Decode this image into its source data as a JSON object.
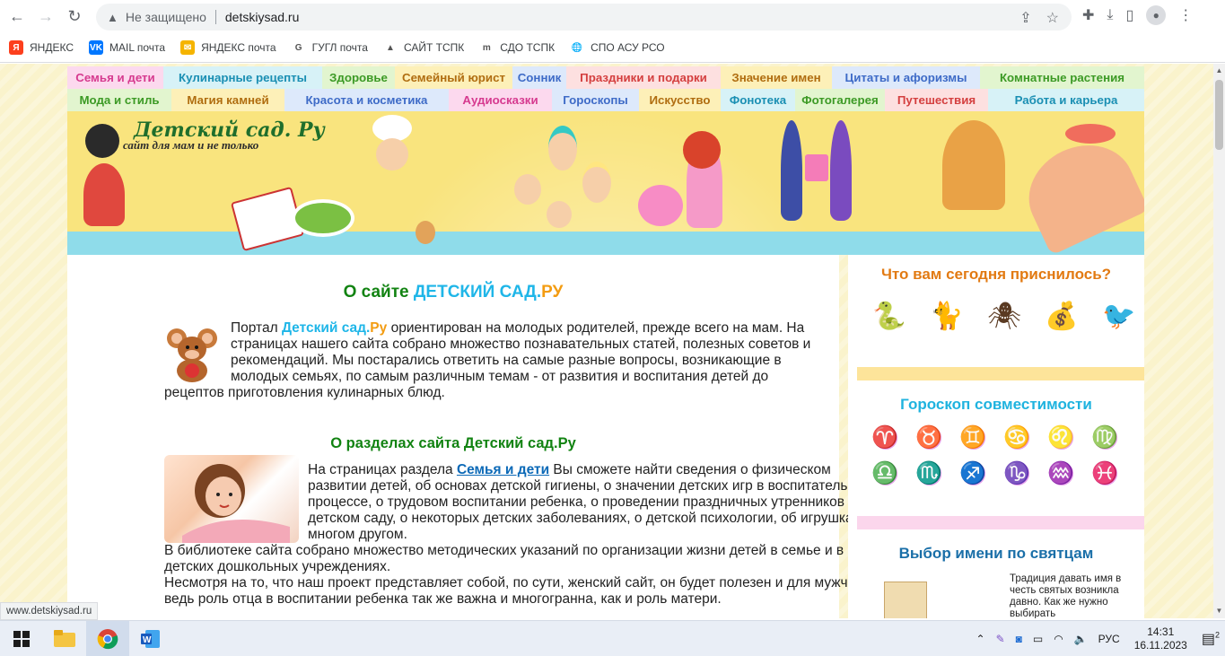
{
  "browser": {
    "security_label": "Не защищено",
    "url": "detskiysad.ru"
  },
  "bookmarks": [
    {
      "label": "ЯНДЕКС",
      "icon": "yandex-icon",
      "color": "#fc3f1d",
      "glyph": "Я"
    },
    {
      "label": "MAIL почта",
      "icon": "vk-icon",
      "color": "#0077ff",
      "glyph": "VK"
    },
    {
      "label": "ЯНДЕКС почта",
      "icon": "mail-icon",
      "color": "#f5b400",
      "glyph": "✉"
    },
    {
      "label": "ГУГЛ почта",
      "icon": "google-icon",
      "color": "#ffffff",
      "glyph": "G"
    },
    {
      "label": "САЙТ ТСПК",
      "icon": "triangle-icon",
      "color": "#ffffff",
      "glyph": "▲"
    },
    {
      "label": "СДО ТСПК",
      "icon": "moodle-icon",
      "color": "#ffffff",
      "glyph": "m"
    },
    {
      "label": "СПО АСУ РСО",
      "icon": "globe-icon",
      "color": "#ffffff",
      "glyph": "🌐"
    }
  ],
  "menu_row1": [
    {
      "label": "Семья и дети",
      "bg": "#fcd9ee",
      "fg": "#d63a8f",
      "w": 107
    },
    {
      "label": "Кулинарные рецепты",
      "bg": "#d7f2f7",
      "fg": "#1a8fb3",
      "w": 177
    },
    {
      "label": "Здоровье",
      "bg": "#e2f5cf",
      "fg": "#3c9a25",
      "w": 81
    },
    {
      "label": "Семейный юрист",
      "bg": "#fdf0b8",
      "fg": "#b06d10",
      "w": 131
    },
    {
      "label": "Сонник",
      "bg": "#dde9fb",
      "fg": "#3e6bc7",
      "w": 60
    },
    {
      "label": "Праздники и подарки",
      "bg": "#fde0e0",
      "fg": "#d43f3f",
      "w": 172
    },
    {
      "label": "Значение имен",
      "bg": "#fdf0b8",
      "fg": "#b06d10",
      "w": 124
    },
    {
      "label": "Цитаты и афоризмы",
      "bg": "#dde9fb",
      "fg": "#3e6bc7",
      "w": 165
    },
    {
      "label": "Комнатные растения",
      "bg": "#e2f5cf",
      "fg": "#3c9a25",
      "w": 183
    }
  ],
  "menu_row2": [
    {
      "label": "Мода и стиль",
      "bg": "#e2f5cf",
      "fg": "#3c9a25",
      "w": 116
    },
    {
      "label": "Магия камней",
      "bg": "#fdf0b8",
      "fg": "#b06d10",
      "w": 126
    },
    {
      "label": "Красота и косметика",
      "bg": "#dde9fb",
      "fg": "#3e6bc7",
      "w": 183
    },
    {
      "label": "Аудиосказки",
      "bg": "#fcd9ee",
      "fg": "#d63a8f",
      "w": 115
    },
    {
      "label": "Гороскопы",
      "bg": "#dde9fb",
      "fg": "#3e6bc7",
      "w": 97
    },
    {
      "label": "Искусство",
      "bg": "#fdf0b8",
      "fg": "#b06d10",
      "w": 91
    },
    {
      "label": "Фонотека",
      "bg": "#d7f2f7",
      "fg": "#1a8fb3",
      "w": 83
    },
    {
      "label": "Фотогалерея",
      "bg": "#e2f5cf",
      "fg": "#3c9a25",
      "w": 100
    },
    {
      "label": "Путешествия",
      "bg": "#fde0e0",
      "fg": "#d43f3f",
      "w": 115
    },
    {
      "label": "Работа и карьера",
      "bg": "#d7f2f7",
      "fg": "#1a8fb3",
      "w": 174
    }
  ],
  "banner": {
    "logo": "Детский сад. Ру",
    "subtitle": "сайт для мам и не только"
  },
  "about": {
    "title_prefix": "О сайте ",
    "title_brand": "ДЕТСКИЙ САД.",
    "title_suffix": "РУ",
    "text_before": "Портал ",
    "brand_name": "Детский сад.",
    "brand_ru": "Ру",
    "text_after": " ориентирован на молодых родителей, прежде всего на мам. На страницах нашего сайта собрано множество познавательных статей, полезных советов и рекомендаций. Мы постарались ответить на самые разные вопросы, возникающие в молодых семьях, по самым различным темам - от развития и воспитания детей до рецептов приготовления кулинарных блюд."
  },
  "sections": {
    "title": "О разделах сайта Детский сад.Ру",
    "text_before": "На страницах раздела ",
    "link": "Семья и дети",
    "text_after": " Вы сможете найти сведения о физическом развитии детей, об основах детской гигиены, о значении детских игр в воспитательном процессе, о трудовом воспитании ребенка, о проведении праздничных утренников в детском саду, о некоторых детских заболеваниях, о детской психологии, об игрушках и о многом другом.",
    "para2": "В библиотеке сайта собрано множество методических указаний по организации жизни детей в семье и в детских дошкольных учреждениях.",
    "para3": "Несмотря на то, что наш проект представляет собой, по сути, женский сайт, он будет полезен и для мужчин - ведь роль отца в воспитании ребенка так же важна и многогранна, как и роль матери."
  },
  "sidebar": {
    "dream_title": "Что вам сегодня приснилось?",
    "dreams": [
      "snake-icon",
      "cat-icon",
      "spider-icon",
      "money-bag-icon",
      "raven-icon"
    ],
    "horoscope_title": "Гороскоп совместимости",
    "zodiac": [
      "♈",
      "♉",
      "♊",
      "♋",
      "♌",
      "♍",
      "♎",
      "♏",
      "♐",
      "♑",
      "♒",
      "♓"
    ],
    "names_title": "Выбор имени по святцам",
    "names_text": "Традиция давать имя в честь святых возникла давно. Как же нужно выбирать"
  },
  "status_url": "www.detskiysad.ru",
  "taskbar": {
    "lang": "РУС",
    "time": "14:31",
    "date": "16.11.2023",
    "notif_count": "2"
  }
}
